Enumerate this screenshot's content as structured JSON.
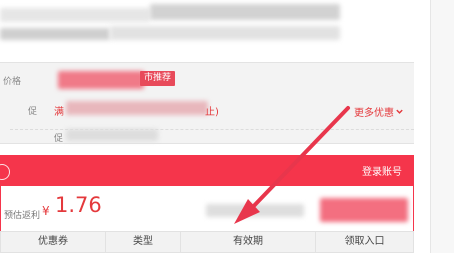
{
  "product": {
    "price_label": "价格",
    "promo_tag": "市推荐"
  },
  "promotion": {
    "label": "促",
    "full_reduction_prefix": "满",
    "paren_text": "止)",
    "more_label": "更多优惠",
    "more_icon": "chevron-down-icon",
    "sub_label": "促"
  },
  "coupon": {
    "login_label": "登录账号",
    "price_label": "预估返利",
    "currency": "¥",
    "amount": "1.76",
    "columns": [
      "优惠券",
      "类型",
      "有效期",
      "领取入口"
    ]
  },
  "colors": {
    "accent": "#f5354b",
    "price_red": "#e4393c",
    "tag_pink": "#e84a5a"
  }
}
